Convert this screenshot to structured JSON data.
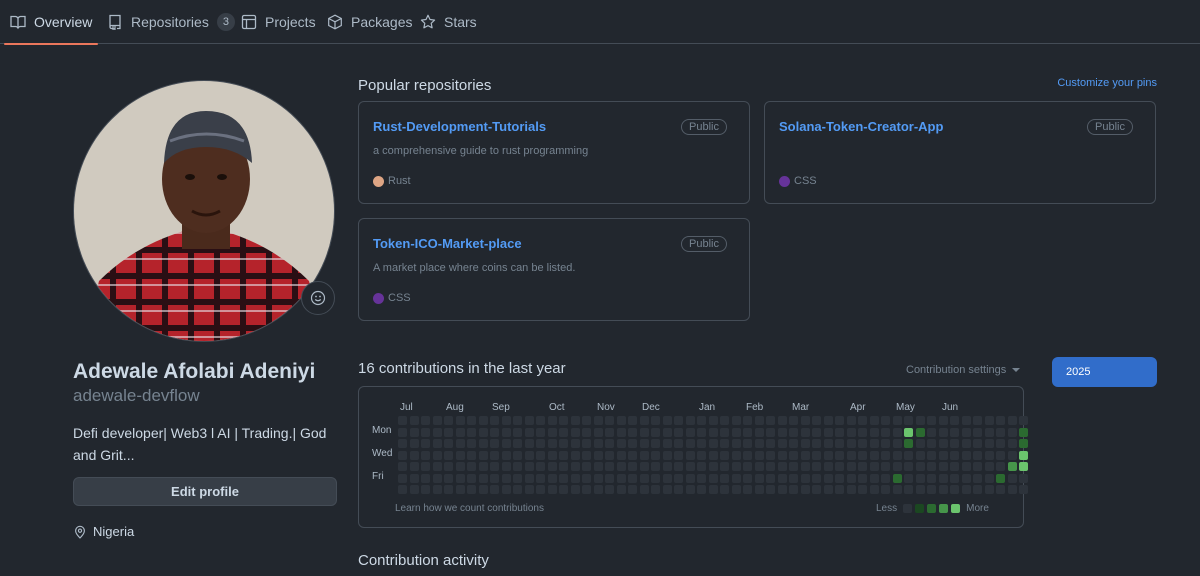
{
  "nav": {
    "tabs": [
      {
        "label": "Overview",
        "icon": "book-icon",
        "active": true
      },
      {
        "label": "Repositories",
        "icon": "repo-icon",
        "count": "3"
      },
      {
        "label": "Projects",
        "icon": "table-icon"
      },
      {
        "label": "Packages",
        "icon": "package-icon"
      },
      {
        "label": "Stars",
        "icon": "star-icon"
      }
    ]
  },
  "profile": {
    "full_name": "Adewale Afolabi Adeniyi",
    "username": "adewale-devflow",
    "bio": "Defi developer| Web3 l AI | Trading.| God and Grit...",
    "edit_label": "Edit profile",
    "location": "Nigeria"
  },
  "pinned": {
    "title": "Popular repositories",
    "customize_label": "Customize your pins",
    "repos": [
      {
        "name": "Rust-Development-Tutorials",
        "visibility": "Public",
        "description": "a comprehensive guide to rust programming",
        "language": "Rust",
        "language_color": "#dea584"
      },
      {
        "name": "Solana-Token-Creator-App",
        "visibility": "Public",
        "description": "",
        "language": "CSS",
        "language_color": "#663399"
      },
      {
        "name": "Token-ICO-Market-place",
        "visibility": "Public",
        "description": "A market place where coins can be listed.",
        "language": "CSS",
        "language_color": "#663399"
      }
    ]
  },
  "contributions": {
    "title": "16 contributions in the last year",
    "settings_label": "Contribution settings",
    "year": "2025",
    "months": [
      "Jul",
      "Aug",
      "Sep",
      "Oct",
      "Nov",
      "Dec",
      "Jan",
      "Feb",
      "Mar",
      "Apr",
      "May",
      "Jun"
    ],
    "days": [
      "Mon",
      "Wed",
      "Fri"
    ],
    "learn_label": "Learn how we count contributions",
    "legend_less": "Less",
    "legend_more": "More",
    "levels": [
      "#2d333b",
      "#1b4721",
      "#2b6a30",
      "#46954a",
      "#6bc46d"
    ],
    "active_cells": [
      {
        "week": 44,
        "day": 1,
        "level": 4
      },
      {
        "week": 44,
        "day": 2,
        "level": 2
      },
      {
        "week": 43,
        "day": 5,
        "level": 2
      },
      {
        "week": 45,
        "day": 1,
        "level": 2
      },
      {
        "week": 52,
        "day": 5,
        "level": 2
      },
      {
        "week": 53,
        "day": 4,
        "level": 3
      },
      {
        "week": 54,
        "day": 1,
        "level": 2
      },
      {
        "week": 54,
        "day": 2,
        "level": 2
      },
      {
        "week": 54,
        "day": 3,
        "level": 4
      },
      {
        "week": 54,
        "day": 4,
        "level": 4
      },
      {
        "week": 53,
        "day": 7,
        "level": 4
      }
    ]
  },
  "activity": {
    "title": "Contribution activity"
  }
}
